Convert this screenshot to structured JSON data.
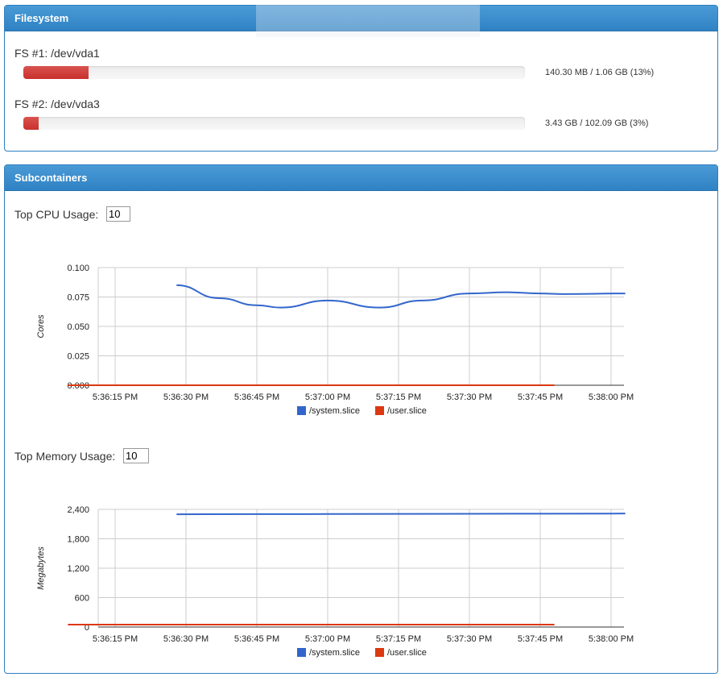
{
  "filesystem": {
    "title": "Filesystem",
    "items": [
      {
        "label": "FS #1: /dev/vda1",
        "usage": "140.30 MB / 1.06 GB (13%)",
        "fraction": 0.13
      },
      {
        "label": "FS #2: /dev/vda3",
        "usage": "3.43 GB / 102.09 GB (3%)",
        "fraction": 0.03
      }
    ]
  },
  "subcontainers": {
    "title": "Subcontainers",
    "cpu_label": "Top CPU Usage:",
    "cpu_value": "10",
    "mem_label": "Top Memory Usage:",
    "mem_value": "10"
  },
  "colors": {
    "system": "#3366cc",
    "user": "#dc3912",
    "fill": "#d9534f",
    "header": "#337ab7"
  },
  "chart_data": [
    {
      "type": "line",
      "title": "",
      "xlabel": "",
      "ylabel": "Cores",
      "ylim": [
        0,
        0.1
      ],
      "yticks": [
        "0.000",
        "0.025",
        "0.050",
        "0.075",
        "0.100"
      ],
      "xticks": [
        "5:36:15 PM",
        "5:36:30 PM",
        "5:36:45 PM",
        "5:37:00 PM",
        "5:37:15 PM",
        "5:37:30 PM",
        "5:37:45 PM",
        "5:38:00 PM"
      ],
      "x": [
        "5:36:28 PM",
        "5:36:37 PM",
        "5:36:45 PM",
        "5:36:50 PM",
        "5:37:00 PM",
        "5:37:11 PM",
        "5:37:20 PM",
        "5:37:30 PM",
        "5:37:38 PM",
        "5:37:45 PM",
        "5:37:50 PM",
        "5:38:03 PM"
      ],
      "grid": true,
      "legend": "bottom",
      "series": [
        {
          "name": "/system.slice",
          "color": "#3366cc",
          "x_sec": [
            28,
            37,
            45,
            50,
            60,
            71,
            80,
            90,
            98,
            105,
            110,
            123
          ],
          "values": [
            0.085,
            0.074,
            0.068,
            0.066,
            0.072,
            0.066,
            0.072,
            0.078,
            0.079,
            0.078,
            0.0775,
            0.078
          ]
        },
        {
          "name": "/user.slice",
          "color": "#dc3912",
          "x_sec": [
            5,
            108
          ],
          "values": [
            0.0,
            0.0
          ]
        }
      ]
    },
    {
      "type": "line",
      "title": "",
      "xlabel": "",
      "ylabel": "Megabytes",
      "ylim": [
        0,
        2400
      ],
      "yticks": [
        "0",
        "600",
        "1,200",
        "1,800",
        "2,400"
      ],
      "xticks": [
        "5:36:15 PM",
        "5:36:30 PM",
        "5:36:45 PM",
        "5:37:00 PM",
        "5:37:15 PM",
        "5:37:30 PM",
        "5:37:45 PM",
        "5:38:00 PM"
      ],
      "grid": true,
      "legend": "bottom",
      "series": [
        {
          "name": "/system.slice",
          "color": "#3366cc",
          "x_sec": [
            28,
            60,
            90,
            123
          ],
          "values": [
            2300,
            2305,
            2310,
            2315
          ]
        },
        {
          "name": "/user.slice",
          "color": "#dc3912",
          "x_sec": [
            5,
            108
          ],
          "values": [
            50,
            50
          ]
        }
      ]
    }
  ]
}
